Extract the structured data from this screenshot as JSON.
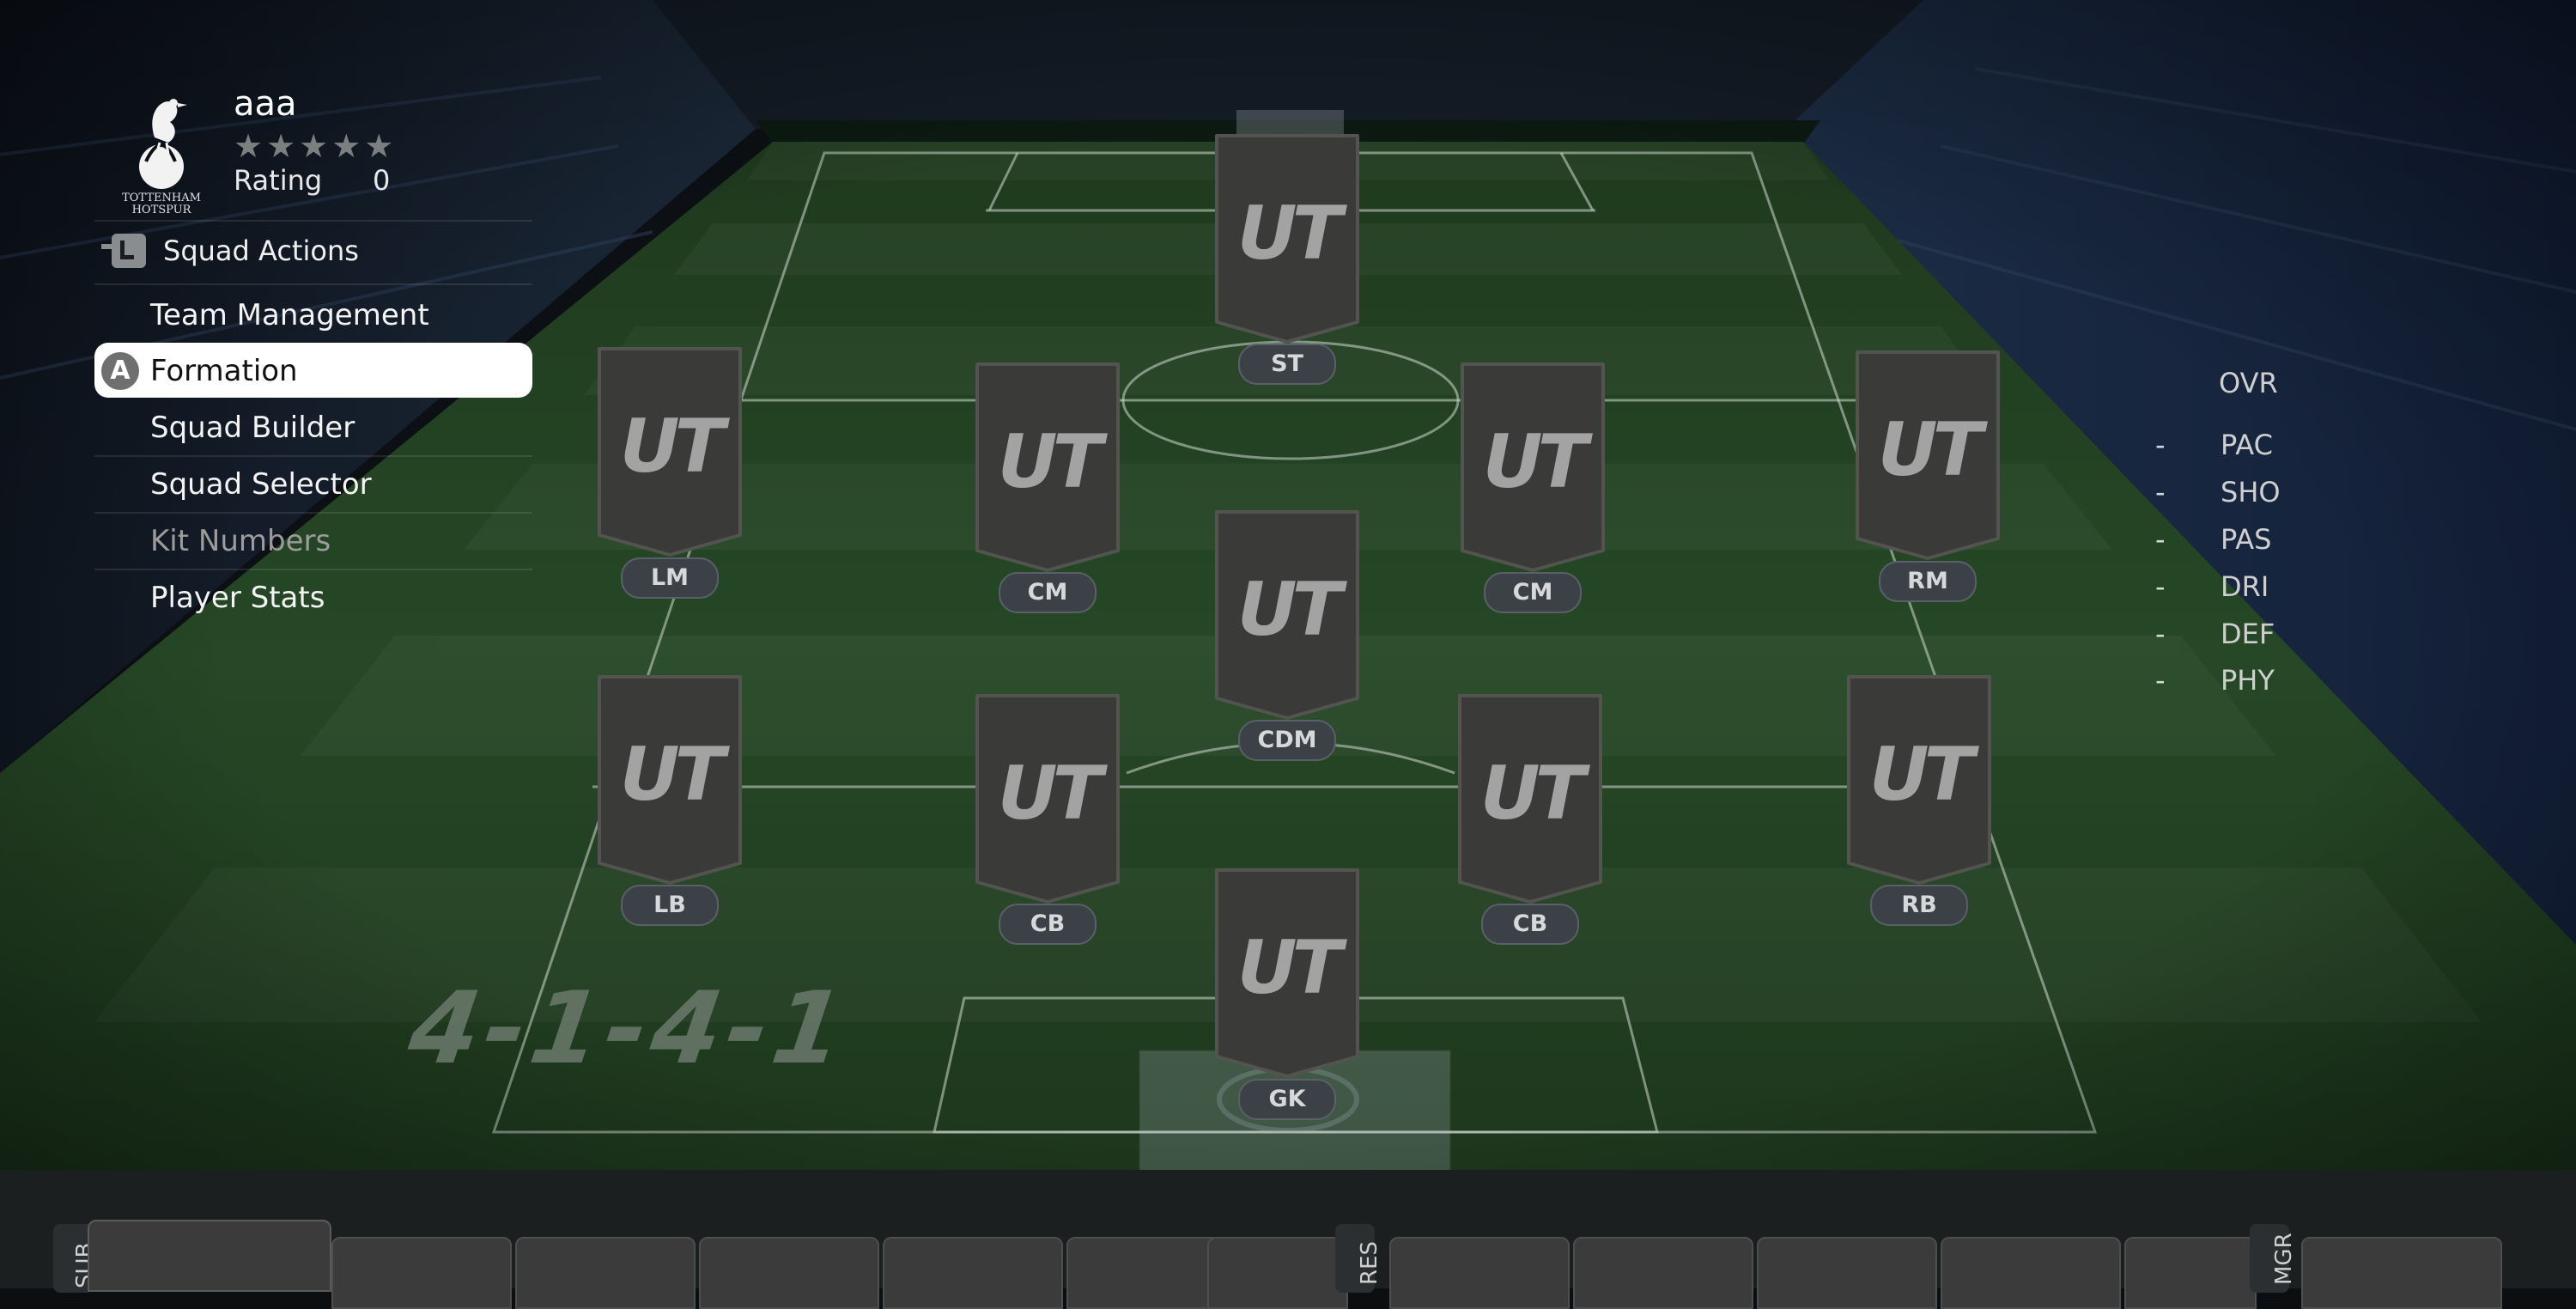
{
  "squad": {
    "name": "aaa",
    "stars": "★★★★★",
    "rating_label": "Rating",
    "rating_value": "0",
    "club_icon": "tottenham-hotspur-crest"
  },
  "menu": {
    "header": "Squad Actions",
    "header_icon": "squad-actions-icon",
    "button_prompt": "A",
    "items": [
      {
        "label": "Team Management",
        "state": "normal"
      },
      {
        "label": "Formation",
        "state": "selected"
      },
      {
        "label": "Squad Builder",
        "state": "normal"
      },
      {
        "label": "Squad Selector",
        "state": "normal"
      },
      {
        "label": "Kit Numbers",
        "state": "disabled"
      },
      {
        "label": "Player Stats",
        "state": "normal"
      }
    ]
  },
  "formation": "4-1-4-1",
  "card_logo": "UT",
  "positions": [
    "ST",
    "LM",
    "CM",
    "CM",
    "RM",
    "CDM",
    "LB",
    "CB",
    "CB",
    "RB",
    "GK"
  ],
  "stats": {
    "ovr": "OVR",
    "dash": "-",
    "items": [
      "PAC",
      "SHO",
      "PAS",
      "DRI",
      "DEF",
      "PHY"
    ]
  },
  "bench": {
    "res_label": "RES",
    "mgr_label": "MGR",
    "sub_label": "SUB"
  },
  "colors": {
    "pitch": "#1e3a1e",
    "card": "#3a3a38",
    "selected_bg": "#ffffff",
    "badge": "#3c4148"
  }
}
